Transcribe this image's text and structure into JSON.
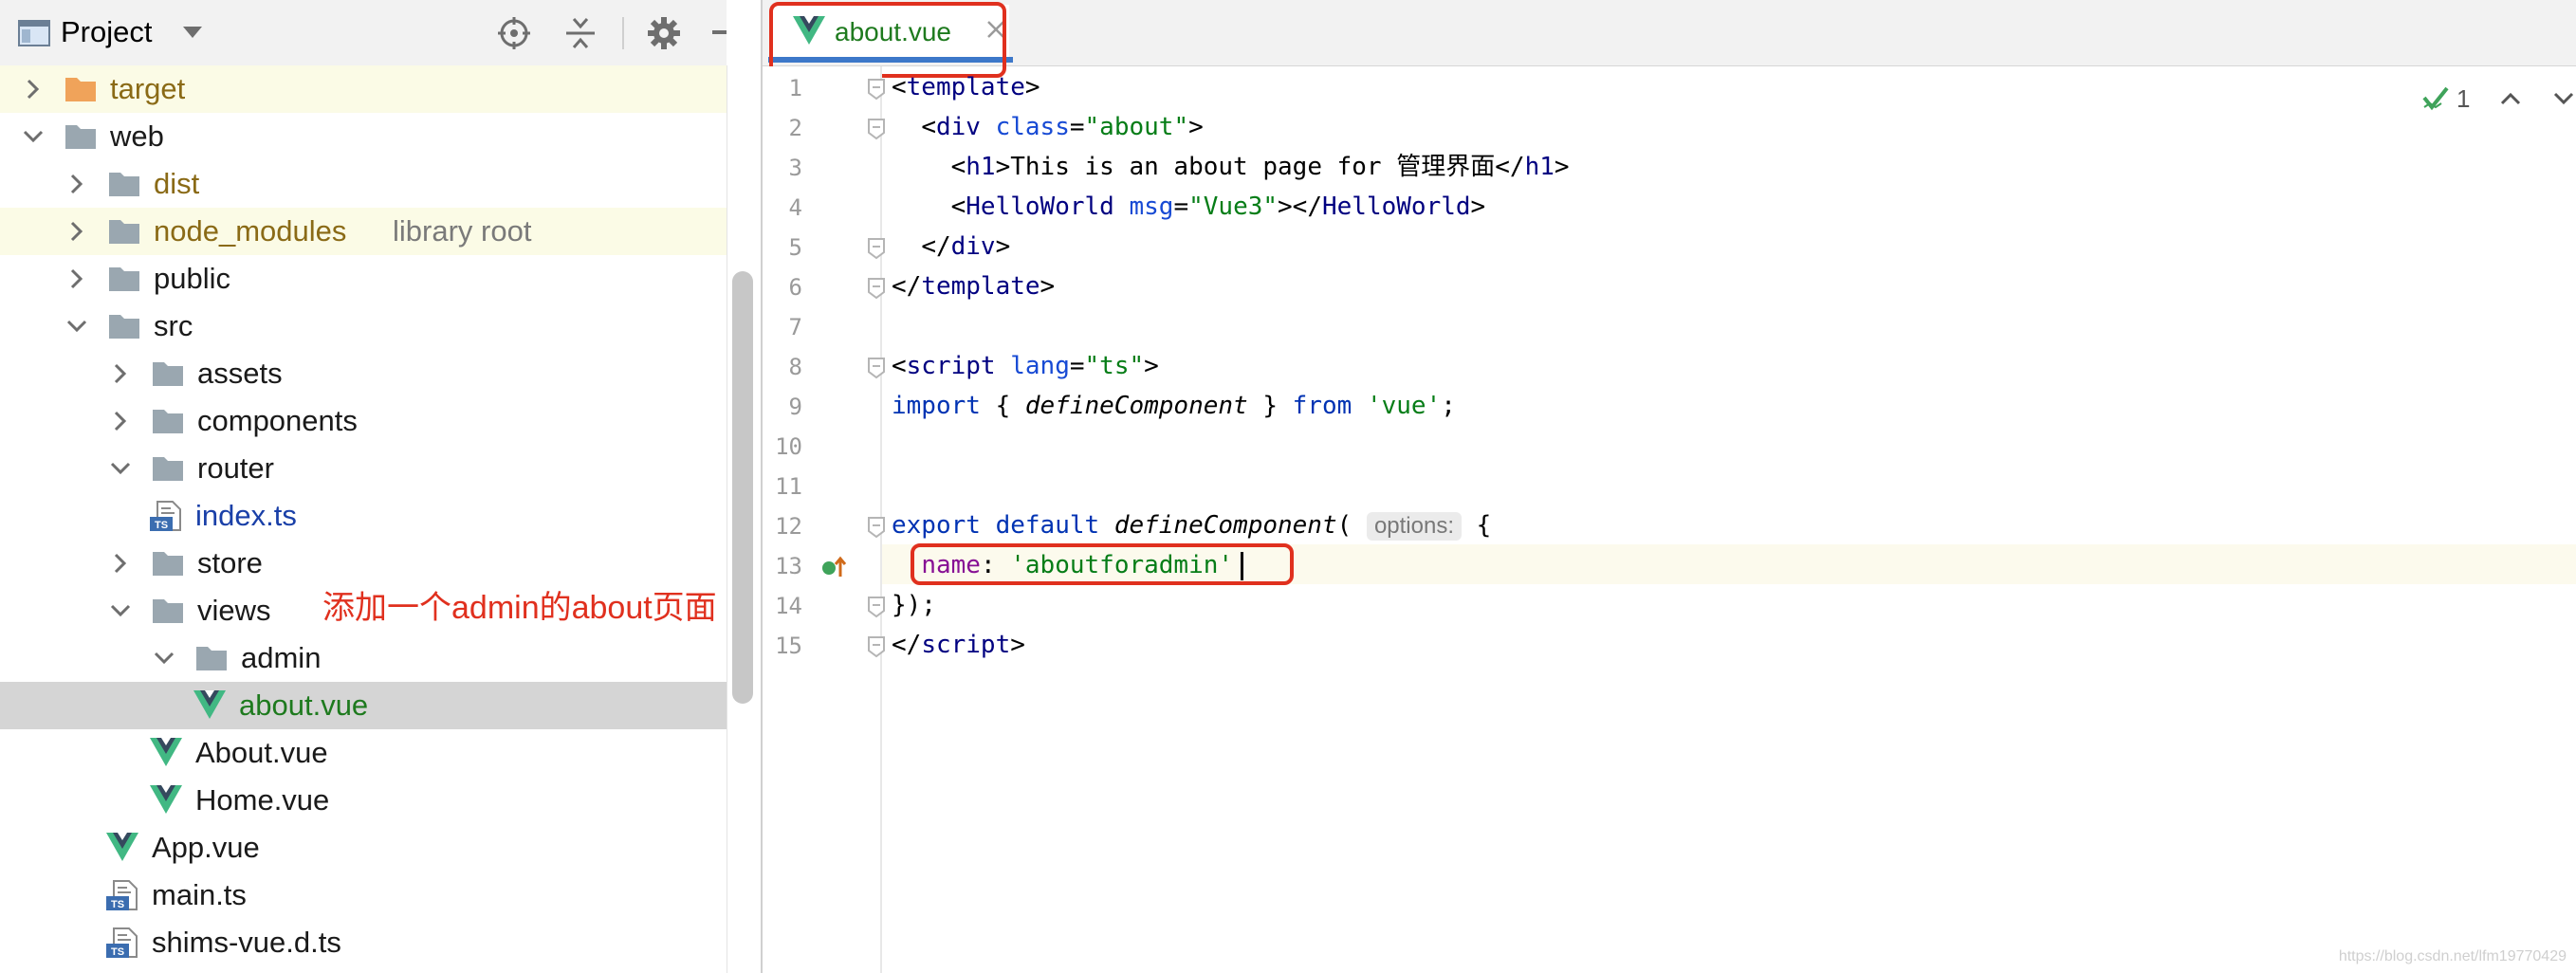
{
  "project_panel": {
    "title": "Project",
    "icons": [
      "window-icon",
      "chevron-down-icon",
      "locate-icon",
      "collapse-all-icon",
      "gear-icon",
      "minimize-icon"
    ]
  },
  "tree": [
    {
      "label": "target",
      "type": "folder-excluded",
      "level": 1,
      "expanded": false
    },
    {
      "label": "web",
      "type": "folder",
      "level": 1,
      "expanded": true
    },
    {
      "label": "dist",
      "type": "folder",
      "level": 2,
      "expanded": false,
      "color": "excluded"
    },
    {
      "label": "node_modules",
      "hint": "library root",
      "type": "folder",
      "level": 2,
      "expanded": false,
      "color": "excluded"
    },
    {
      "label": "public",
      "type": "folder",
      "level": 2,
      "expanded": false
    },
    {
      "label": "src",
      "type": "folder",
      "level": 2,
      "expanded": true
    },
    {
      "label": "assets",
      "type": "folder",
      "level": 3,
      "expanded": false
    },
    {
      "label": "components",
      "type": "folder",
      "level": 3,
      "expanded": false
    },
    {
      "label": "router",
      "type": "folder",
      "level": 3,
      "expanded": true
    },
    {
      "label": "index.ts",
      "type": "ts",
      "level": 4
    },
    {
      "label": "store",
      "type": "folder",
      "level": 3,
      "expanded": false
    },
    {
      "label": "views",
      "type": "folder",
      "level": 3,
      "expanded": true
    },
    {
      "label": "admin",
      "type": "folder",
      "level": 4,
      "expanded": true
    },
    {
      "label": "about.vue",
      "type": "vue",
      "level": 5,
      "selected": true
    },
    {
      "label": "About.vue",
      "type": "vue",
      "level": 4
    },
    {
      "label": "Home.vue",
      "type": "vue",
      "level": 4
    },
    {
      "label": "App.vue",
      "type": "vue",
      "level": 3
    },
    {
      "label": "main.ts",
      "type": "ts",
      "level": 3
    },
    {
      "label": "shims-vue.d.ts",
      "type": "ts",
      "level": 3
    }
  ],
  "annotation": "添加一个admin的about页面",
  "editor": {
    "tab_label": "about.vue",
    "inspection_count": "1",
    "param_hint": "options:",
    "line_numbers": [
      "1",
      "2",
      "3",
      "4",
      "5",
      "6",
      "7",
      "8",
      "9",
      "10",
      "11",
      "12",
      "13",
      "14",
      "15"
    ],
    "code": {
      "l1": {
        "lt": "<",
        "tag": "template",
        "gt": ">"
      },
      "l2": {
        "lt": "<",
        "tag": "div",
        "attr": "class",
        "eq": "=",
        "val": "\"about\"",
        "gt": ">"
      },
      "l3": {
        "lt": "<",
        "tag": "h1",
        "gt": ">",
        "text": "This is an about page for 管理界面",
        "close_lt": "</",
        "close_tag": "h1",
        "close_gt": ">"
      },
      "l4": {
        "lt": "<",
        "tag": "HelloWorld",
        "attr": "msg",
        "eq": "=",
        "val": "\"Vue3\"",
        "mid": "></",
        "close_tag": "HelloWorld",
        "close_gt": ">"
      },
      "l5": {
        "lt": "</",
        "tag": "div",
        "gt": ">"
      },
      "l6": {
        "lt": "</",
        "tag": "template",
        "gt": ">"
      },
      "l8": {
        "lt": "<",
        "tag": "script",
        "attr": "lang",
        "eq": "=",
        "val": "\"ts\"",
        "gt": ">"
      },
      "l9": {
        "kw1": "import",
        "brace_open": " { ",
        "fn": "defineComponent",
        "brace_close": " } ",
        "kw2": "from",
        "sp": " ",
        "str": "'vue'",
        "semi": ";"
      },
      "l12": {
        "kw1": "export",
        "kw2": "default",
        "fn": "defineComponent",
        "paren": "(",
        "brace": " {"
      },
      "l13": {
        "prop": "name",
        "colon": ": ",
        "str": "'aboutforadmin'"
      },
      "l14": {
        "text": "});"
      },
      "l15": {
        "lt": "</",
        "tag": "script",
        "gt": ">"
      }
    }
  },
  "watermark": "https://blog.csdn.net/lfm19770429",
  "colors": {
    "annotation_red": "#e0301e",
    "vue_green": "#41b883",
    "vue_dark": "#35495e",
    "folder_gray": "#9aa7b0",
    "folder_orange": "#f0a35a",
    "tab_underline": "#3d78c9"
  }
}
